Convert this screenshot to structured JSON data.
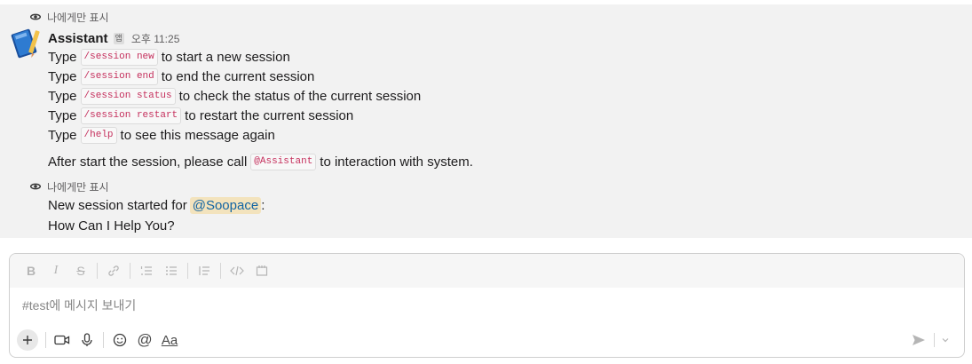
{
  "messages": {
    "only_visible_label_1": "나에게만 표시",
    "sender_name": "Assistant",
    "app_badge": "앱",
    "timestamp": "오후 11:25",
    "commands": [
      {
        "prefix": "Type",
        "code": "/session new",
        "suffix": "to start a new session"
      },
      {
        "prefix": "Type",
        "code": "/session end",
        "suffix": "to end the current session"
      },
      {
        "prefix": "Type",
        "code": "/session status",
        "suffix": "to check the status of the current session"
      },
      {
        "prefix": "Type",
        "code": "/session restart",
        "suffix": "to restart the current session"
      },
      {
        "prefix": "Type",
        "code": "/help",
        "suffix": "to see this message again"
      }
    ],
    "after_prefix": "After start the session, please call",
    "after_code": "@Assistant",
    "after_suffix": "to interaction with system.",
    "only_visible_label_2": "나에게만 표시",
    "session_prefix": "New session started for",
    "session_mention": "@Soopace",
    "session_suffix": ":",
    "help_line": "How Can I Help You?"
  },
  "composer": {
    "placeholder": "#test에 메시지 보내기",
    "format_icons": [
      "bold-icon",
      "italic-icon",
      "strikethrough-icon",
      "link-icon",
      "ordered-list-icon",
      "bulleted-list-icon",
      "blockquote-icon",
      "code-icon",
      "code-block-icon"
    ],
    "bottom_icons": [
      "plus-icon",
      "video-icon",
      "microphone-icon",
      "emoji-icon",
      "mention-icon",
      "format-toggle-icon",
      "send-icon",
      "chevron-down-icon"
    ],
    "format_toggle_label": "Aa",
    "bold_label": "B",
    "italic_label": "I",
    "strike_label": "S",
    "mention_label": "@"
  },
  "colors": {
    "message_bg": "#f2f2f2",
    "code_text": "#c5305d",
    "mention_bg": "#f3e3bd",
    "mention_text": "#1264a3"
  }
}
